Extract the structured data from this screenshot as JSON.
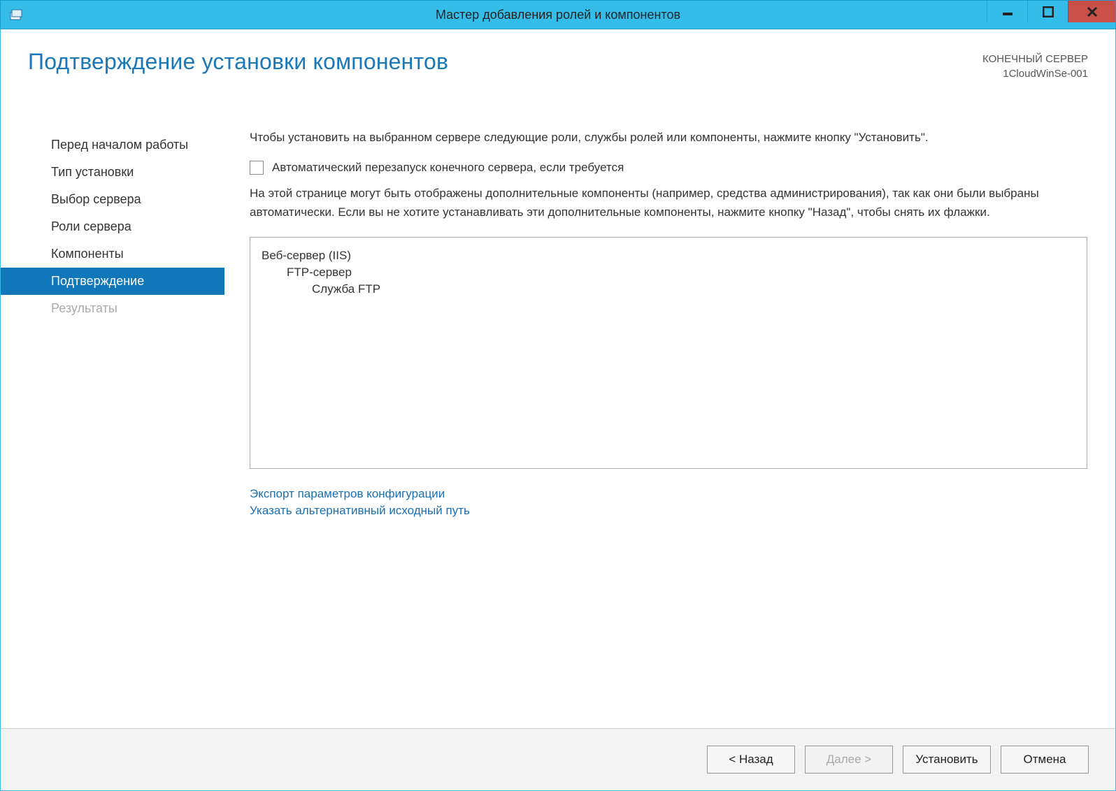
{
  "titlebar": {
    "title": "Мастер добавления ролей и компонентов"
  },
  "header": {
    "page_title": "Подтверждение установки компонентов",
    "server_label": "КОНЕЧНЫЙ СЕРВЕР",
    "server_name": "1CloudWinSe-001"
  },
  "sidebar": {
    "items": [
      {
        "label": "Перед началом работы",
        "state": "normal"
      },
      {
        "label": "Тип установки",
        "state": "normal"
      },
      {
        "label": "Выбор сервера",
        "state": "normal"
      },
      {
        "label": "Роли сервера",
        "state": "normal"
      },
      {
        "label": "Компоненты",
        "state": "normal"
      },
      {
        "label": "Подтверждение",
        "state": "selected"
      },
      {
        "label": "Результаты",
        "state": "disabled"
      }
    ]
  },
  "main": {
    "intro": "Чтобы установить на выбранном сервере следующие роли, службы ролей или компоненты, нажмите кнопку \"Установить\".",
    "checkbox_label": "Автоматический перезапуск конечного сервера, если требуется",
    "checkbox_checked": false,
    "note": "На этой странице могут быть отображены дополнительные компоненты (например, средства администрирования), так как они были выбраны автоматически. Если вы не хотите устанавливать эти дополнительные компоненты, нажмите кнопку \"Назад\", чтобы снять их флажки.",
    "features": [
      {
        "level": 0,
        "label": "Веб-сервер (IIS)"
      },
      {
        "level": 1,
        "label": "FTP-сервер"
      },
      {
        "level": 2,
        "label": "Служба FTP"
      }
    ],
    "links": {
      "export": "Экспорт параметров конфигурации",
      "alt_source": "Указать альтернативный исходный путь"
    }
  },
  "footer": {
    "back": "< Назад",
    "next": "Далее >",
    "install": "Установить",
    "cancel": "Отмена"
  }
}
